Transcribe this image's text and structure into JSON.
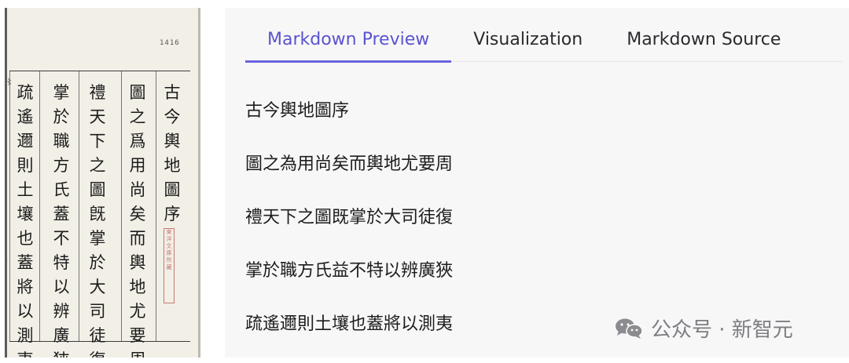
{
  "scan": {
    "page_number": "1416",
    "columns": [
      "古今輿地圖序",
      "圖之爲用尚矣而輿地尤要周",
      "禮天下之圖旣掌於大司徒復",
      "掌於職方氏蓋不特以辨廣狹",
      "疏遙邇則土壤也蓋將以測夷"
    ],
    "stamp_text": "東洋文庫所藏"
  },
  "tabs": [
    {
      "label": "Markdown Preview",
      "active": true
    },
    {
      "label": "Visualization",
      "active": false
    },
    {
      "label": "Markdown Source",
      "active": false
    }
  ],
  "preview_lines": [
    "古今輿地圖序",
    "圖之為用尚矣而輿地尤要周",
    "禮天下之圖既掌於大司徒復",
    "掌於職方氏益不特以辨廣狹",
    "疏遙邇則土壤也蓋將以測夷"
  ],
  "watermark": {
    "text": "公众号 · 新智元",
    "icon": "wechat-icon"
  },
  "colors": {
    "accent": "#5a54cf",
    "panel_bg": "#f7f7f8",
    "paper": "#f1efe6",
    "stamp": "#c77a73"
  }
}
